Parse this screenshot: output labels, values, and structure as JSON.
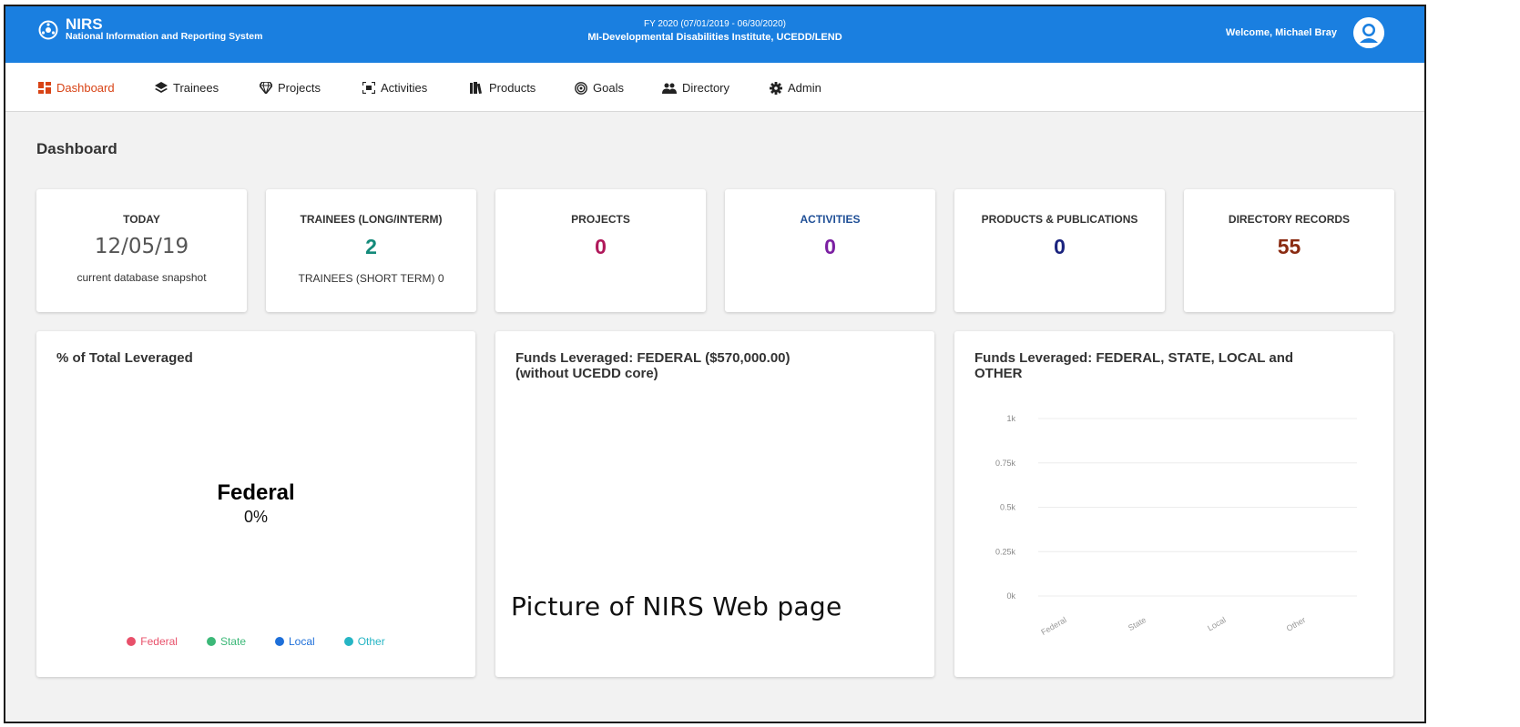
{
  "header": {
    "app_name": "NIRS",
    "app_subtitle": "National Information and Reporting System",
    "fiscal_year": "FY 2020 (07/01/2019 - 06/30/2020)",
    "institute": "MI-Developmental Disabilities Institute, UCEDD/LEND",
    "welcome": "Welcome, Michael Bray"
  },
  "nav": {
    "items": [
      {
        "label": "Dashboard",
        "icon": "dashboard-icon"
      },
      {
        "label": "Trainees",
        "icon": "layers-icon"
      },
      {
        "label": "Projects",
        "icon": "diamond-icon"
      },
      {
        "label": "Activities",
        "icon": "activities-icon"
      },
      {
        "label": "Products",
        "icon": "books-icon"
      },
      {
        "label": "Goals",
        "icon": "target-icon"
      },
      {
        "label": "Directory",
        "icon": "people-icon"
      },
      {
        "label": "Admin",
        "icon": "gear-icon"
      }
    ]
  },
  "page": {
    "title": "Dashboard"
  },
  "stats": [
    {
      "label": "TODAY",
      "value": "12/05/19",
      "sub": "current database snapshot",
      "color": "#555555"
    },
    {
      "label": "TRAINEES (LONG/INTERM)",
      "value": "2",
      "sub": "TRAINEES (SHORT TERM) 0",
      "color": "#138a7a"
    },
    {
      "label": "PROJECTS",
      "value": "0",
      "sub": "",
      "color": "#b0185a"
    },
    {
      "label": "ACTIVITIES",
      "value": "0",
      "sub": "",
      "color": "#7b1fa2",
      "label_color": "#1f4f96"
    },
    {
      "label": "PRODUCTS & PUBLICATIONS",
      "value": "0",
      "sub": "",
      "color": "#1a237e"
    },
    {
      "label": "DIRECTORY RECORDS",
      "value": "55",
      "sub": "",
      "color": "#8a2b12"
    }
  ],
  "panels": {
    "pie": {
      "title": "% of Total Leveraged",
      "center_label": "Federal",
      "center_value": "0%",
      "legend": [
        {
          "label": "Federal",
          "color": "#e8506a"
        },
        {
          "label": "State",
          "color": "#3cb878"
        },
        {
          "label": "Local",
          "color": "#1e6fd9"
        },
        {
          "label": "Other",
          "color": "#26b5c4"
        }
      ]
    },
    "federal": {
      "title_line1": "Funds Leveraged: FEDERAL ($570,000.00)",
      "title_line2": "(without UCEDD core)"
    },
    "all": {
      "title_line1": "Funds Leveraged: FEDERAL, STATE, LOCAL and",
      "title_line2": "OTHER"
    }
  },
  "chart_data": {
    "type": "bar",
    "categories": [
      "Federal",
      "State",
      "Local",
      "Other"
    ],
    "values": [
      0,
      0,
      0,
      0
    ],
    "yticks": [
      "0k",
      "0.25k",
      "0.5k",
      "0.75k",
      "1k"
    ],
    "ylim": [
      0,
      1000
    ],
    "grid": true
  },
  "caption": "Picture of NIRS Web page",
  "colors": {
    "header_blue": "#1a7fe0",
    "active_nav": "#d84315"
  }
}
